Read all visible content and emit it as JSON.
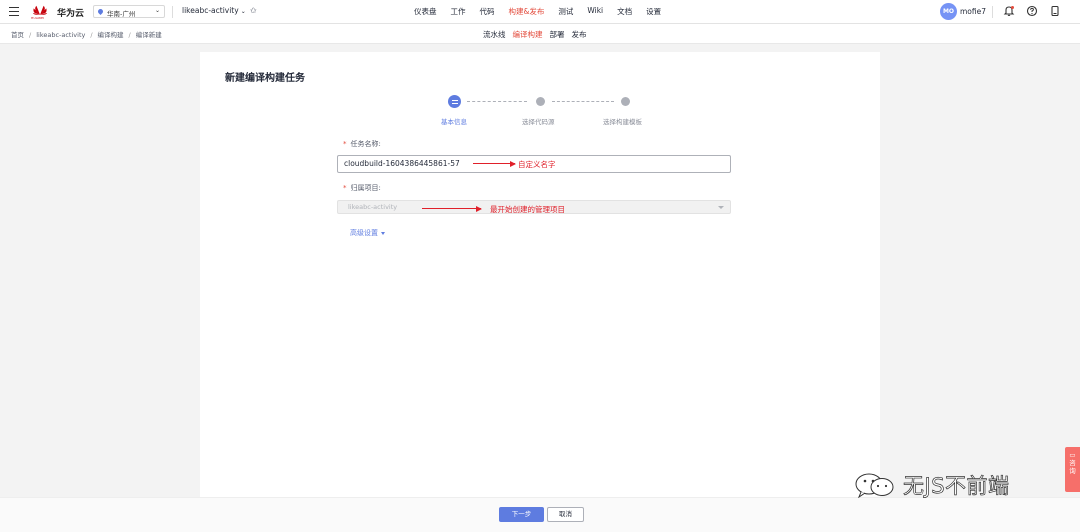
{
  "topbar": {
    "logo_text": "HUAWEI",
    "brand": "华为云",
    "region": "华南-广州",
    "project": "likeabc-activity",
    "nav": [
      "仪表盘",
      "工作",
      "代码",
      "构建&发布",
      "测试",
      "Wiki",
      "文档",
      "设置"
    ],
    "nav_active": "构建&发布",
    "avatar_initials": "MO",
    "username": "mofie7"
  },
  "subbar": {
    "breadcrumb": [
      "首页",
      "likeabc-activity",
      "编译构建",
      "编译新建"
    ],
    "tabs": [
      "流水线",
      "编译构建",
      "部署",
      "发布"
    ],
    "tab_active": "编译构建"
  },
  "form": {
    "title": "新建编译构建任务",
    "steps": [
      "基本信息",
      "选择代码源",
      "选择构建模板"
    ],
    "active_step": 1,
    "name_label": "任务名称:",
    "name_value": "cloudbuild-1604386445861-57",
    "project_label": "归属项目:",
    "project_value": "likeabc-activity",
    "advanced": "高级设置"
  },
  "annotations": {
    "name_note": "自定义名字",
    "project_note": "最开始创建的管理项目"
  },
  "footer": {
    "next": "下一步",
    "cancel": "取消"
  },
  "watermark": "无JS不前端",
  "feedback": [
    "咨",
    "询"
  ],
  "colors": {
    "primary": "#5e7ce0",
    "accent_red": "#e34a3b",
    "annotation_red": "#e0202a"
  }
}
